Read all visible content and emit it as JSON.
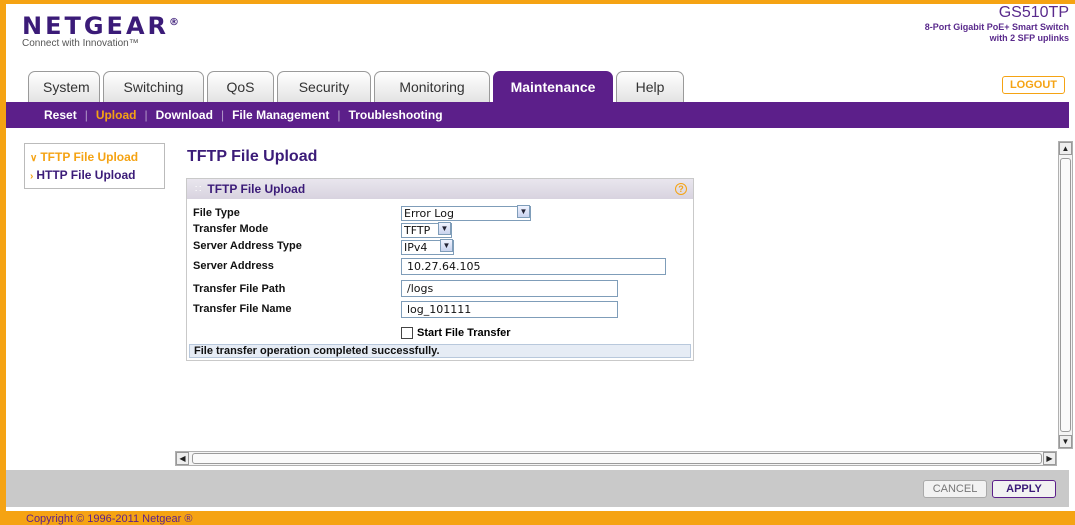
{
  "header": {
    "logo": "NETGEAR",
    "logo_reg": "®",
    "tagline": "Connect with Innovation™",
    "model_name": "GS510TP",
    "model_desc_1": "8-Port Gigabit PoE+ Smart Switch",
    "model_desc_2": "with 2 SFP uplinks",
    "logout_label": "LOGOUT"
  },
  "tabs": [
    "System",
    "Switching",
    "QoS",
    "Security",
    "Monitoring",
    "Maintenance",
    "Help"
  ],
  "active_tab": "Maintenance",
  "subnav": [
    "Reset",
    "Upload",
    "Download",
    "File Management",
    "Troubleshooting"
  ],
  "active_subnav": "Upload",
  "leftmenu": {
    "items": [
      "TFTP File Upload",
      "HTTP File Upload"
    ],
    "active": "TFTP File Upload"
  },
  "page_title": "TFTP File Upload",
  "panel": {
    "title": "TFTP File Upload",
    "help_icon": "?",
    "fields": {
      "file_type_label": "File Type",
      "file_type_value": "Error Log",
      "transfer_mode_label": "Transfer Mode",
      "transfer_mode_value": "TFTP",
      "server_address_type_label": "Server Address Type",
      "server_address_type_value": "IPv4",
      "server_address_label": "Server Address",
      "server_address_value": "10.27.64.105",
      "transfer_file_path_label": "Transfer File Path",
      "transfer_file_path_value": "/logs",
      "transfer_file_name_label": "Transfer File Name",
      "transfer_file_name_value": "log_101111",
      "start_transfer_label": "Start File Transfer"
    },
    "status": "File transfer operation completed successfully."
  },
  "footer": {
    "cancel_label": "CANCEL",
    "apply_label": "APPLY",
    "copyright": "Copyright © 1996-2011 Netgear ®"
  },
  "colors": {
    "accent_orange": "#f5a313",
    "brand_purple": "#5c1f8a"
  }
}
